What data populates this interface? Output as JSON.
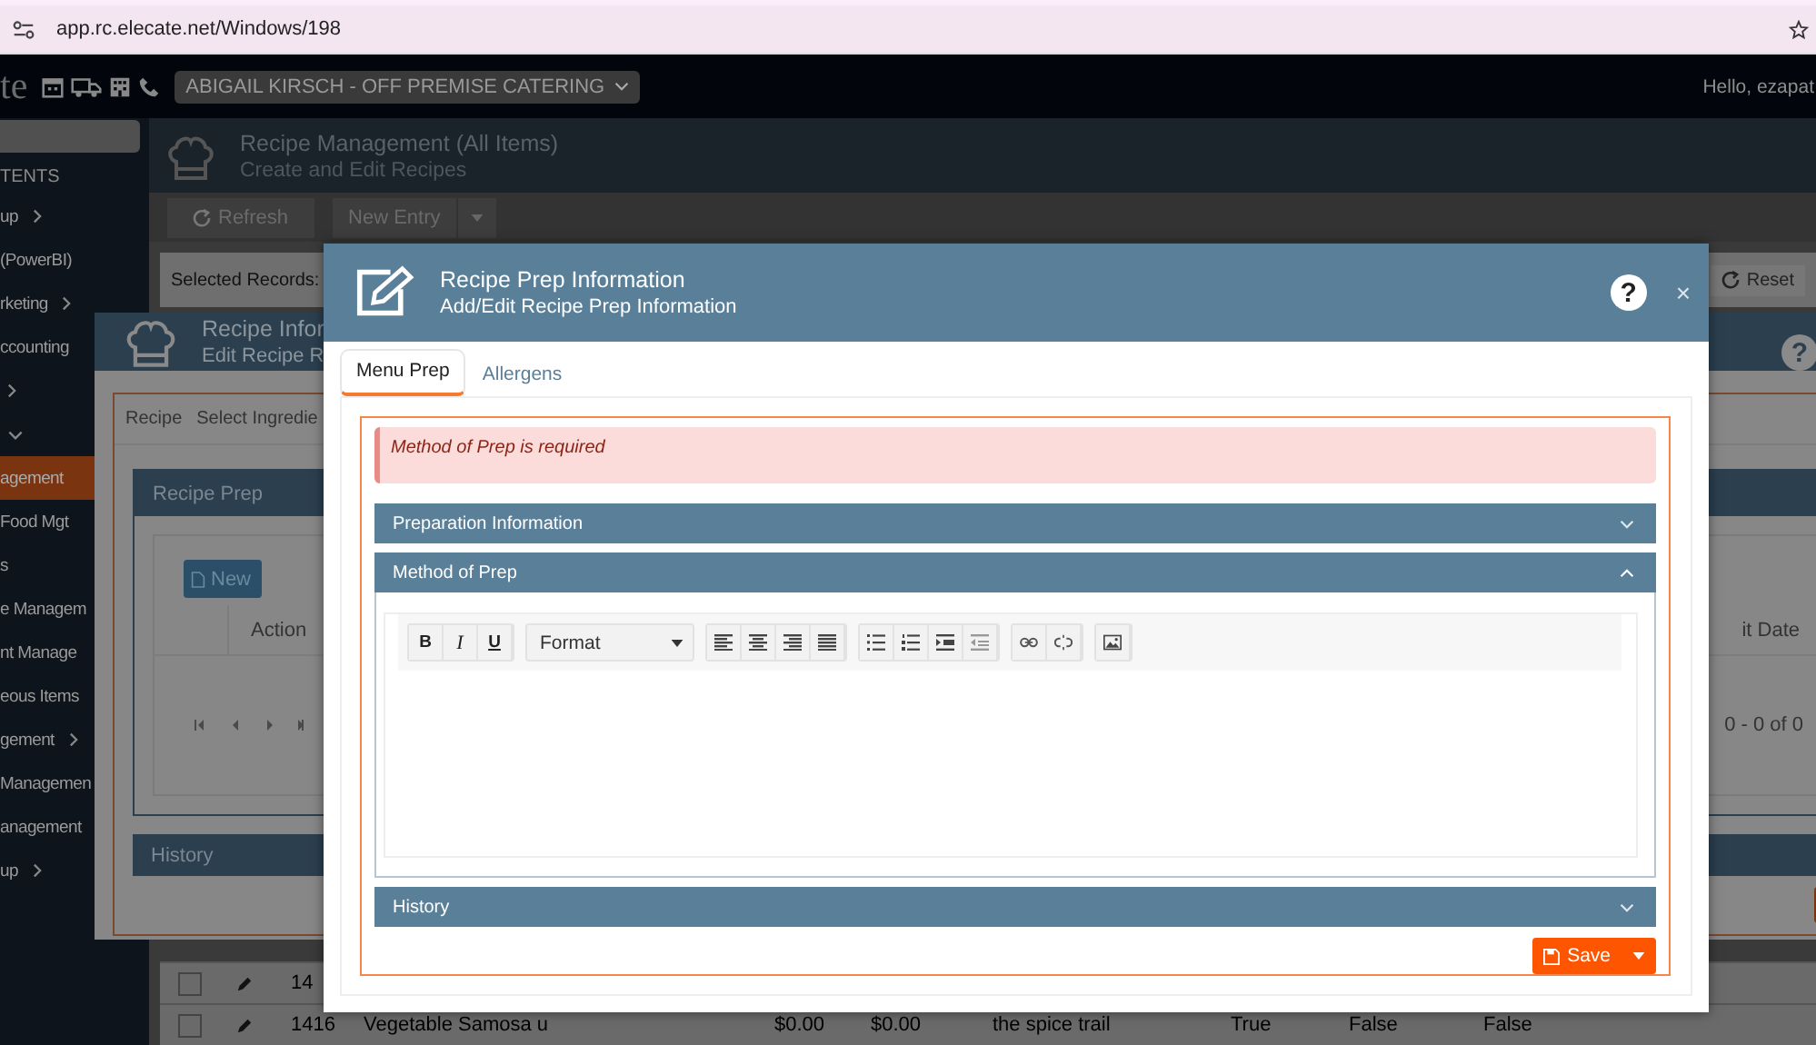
{
  "browser": {
    "url": "app.rc.elecate.net/Windows/198"
  },
  "topbar": {
    "logo": "te",
    "company": "ABIGAIL KIRSCH - OFF PREMISE CATERING",
    "greeting": "Hello, ezapat"
  },
  "sidebar": {
    "heading": "TENTS",
    "items": [
      {
        "label": "up",
        "expanded": false,
        "selected": false
      },
      {
        "label": "(PowerBI)",
        "selected": false
      },
      {
        "label": "rketing",
        "expanded": false,
        "selected": false
      },
      {
        "label": "ccounting",
        "selected": false
      },
      {
        "expanded": false,
        "selected": false
      },
      {
        "expanded": true,
        "selected": false
      },
      {
        "label": "agement",
        "selected": true
      },
      {
        "label": "Food Mgt",
        "selected": false
      },
      {
        "label": "s",
        "selected": false
      },
      {
        "label": "e Managem",
        "selected": false
      },
      {
        "label": "nt Manage",
        "selected": false
      },
      {
        "label": "eous Items",
        "selected": false
      },
      {
        "label": "gement",
        "expanded": false,
        "selected": false
      },
      {
        "label": "Managemen",
        "selected": false
      },
      {
        "label": "anagement",
        "selected": false
      },
      {
        "label": "up",
        "expanded": false,
        "selected": false
      }
    ]
  },
  "page": {
    "title": "Recipe Management (All Items)",
    "subtitle": "Create and Edit Recipes",
    "toolbar": [
      "Refresh",
      "New Entry"
    ],
    "selected_records": "Selected Records:",
    "reset": "Reset",
    "rows": [
      {
        "checked": false,
        "cells": [
          "14"
        ]
      },
      {
        "checked": false,
        "cells": [
          "1416",
          "Vegetable Samosa u",
          "$0.00",
          "$0.00",
          "the spice trail",
          "True",
          "False",
          "False"
        ]
      }
    ]
  },
  "recipe_window": {
    "title": "Recipe Infor",
    "subtitle": "Edit Recipe R",
    "help": "?",
    "tabs": [
      "Recipe",
      "Select Ingredie"
    ],
    "panel": "Recipe Prep",
    "new_button": "New",
    "columns": [
      "Action",
      "it Date"
    ],
    "pager": "0 - 0 of 0",
    "history": "History"
  },
  "prep_window": {
    "title": "Recipe Prep Information",
    "subtitle": "Add/Edit Recipe Prep Information",
    "help": "?",
    "close": "×",
    "tabs": [
      {
        "label": "Menu Prep",
        "selected": true
      },
      {
        "label": "Allergens",
        "selected": false
      }
    ],
    "alert": "Method of Prep is required",
    "sections": [
      {
        "title": "Preparation Information",
        "expanded": false,
        "kind": "plain"
      },
      {
        "title": "Method of Prep",
        "expanded": true,
        "kind": "editor"
      },
      {
        "title": "History",
        "expanded": false,
        "kind": "plain"
      }
    ],
    "editor": {
      "format_buttons": [
        "B",
        "I",
        "U"
      ],
      "format_select": "Format"
    },
    "save": "Save"
  }
}
